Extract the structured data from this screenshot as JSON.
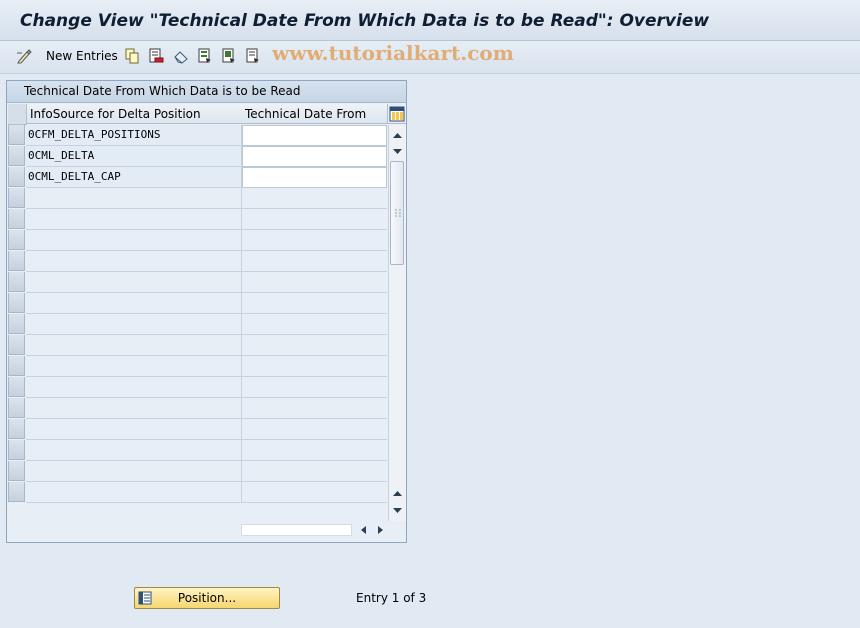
{
  "window": {
    "title": "Change View \"Technical Date From Which Data is to be Read\": Overview"
  },
  "toolbar": {
    "new_entries_label": "New Entries",
    "icons": [
      "display-change-icon",
      "copy-icon",
      "delete-icon",
      "undo-icon",
      "select-all-icon",
      "select-block-icon",
      "deselect-all-icon"
    ]
  },
  "watermark": {
    "text": "www.tutorialkart.com"
  },
  "table": {
    "title": "Technical Date From Which Data is to be Read",
    "columns": [
      "InfoSource for Delta Position",
      "Technical Date From"
    ],
    "rows": [
      {
        "infosource": "0CFM_DELTA_POSITIONS",
        "tech_date": ""
      },
      {
        "infosource": "0CML_DELTA",
        "tech_date": ""
      },
      {
        "infosource": "0CML_DELTA_CAP",
        "tech_date": ""
      }
    ],
    "empty_rows": 15
  },
  "footer": {
    "position_button_label": "Position...",
    "entry_info": "Entry 1 of 3"
  },
  "colors": {
    "background": "#e1e9f2",
    "title_text": "#0f1f33",
    "button_fill": "#f6d66e",
    "watermark": "#e0ad77"
  }
}
